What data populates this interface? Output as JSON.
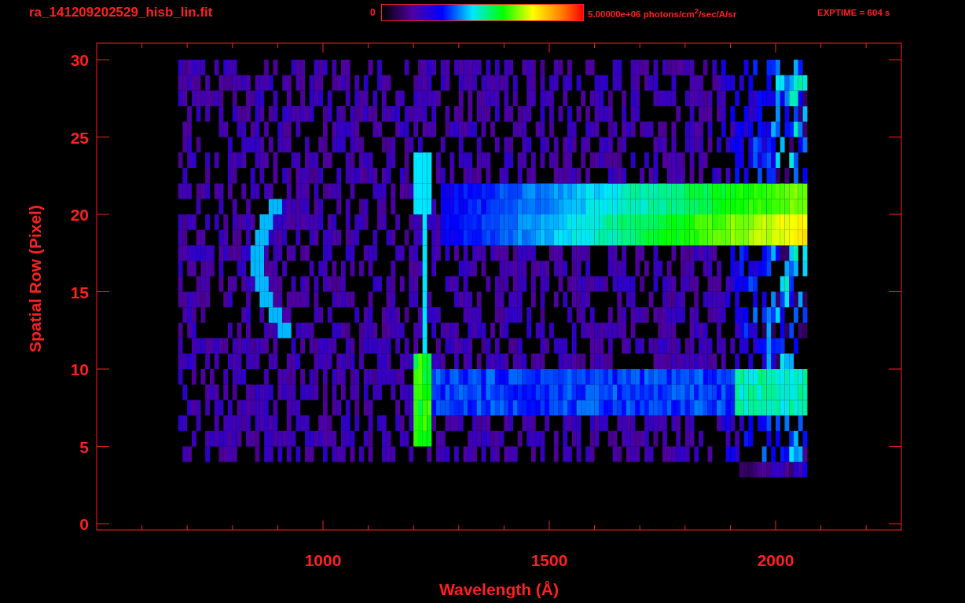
{
  "window": {
    "title": "ra_141209202529_hisb_lin.fit"
  },
  "colorbar": {
    "min_label": "0",
    "max_label": "5.00000e+06 photons/cm$^{2}$/sec/A/sr"
  },
  "exptime": "EXPTIME = 604 s",
  "plot": {
    "xlabel": "Wavelength (Å)",
    "ylabel": "Spatial Row (Pixel)",
    "xticks": [
      "1000",
      "1500",
      "2000"
    ],
    "yticks": [
      "30",
      "25",
      "20",
      "15",
      "10",
      "5",
      "0"
    ]
  }
}
